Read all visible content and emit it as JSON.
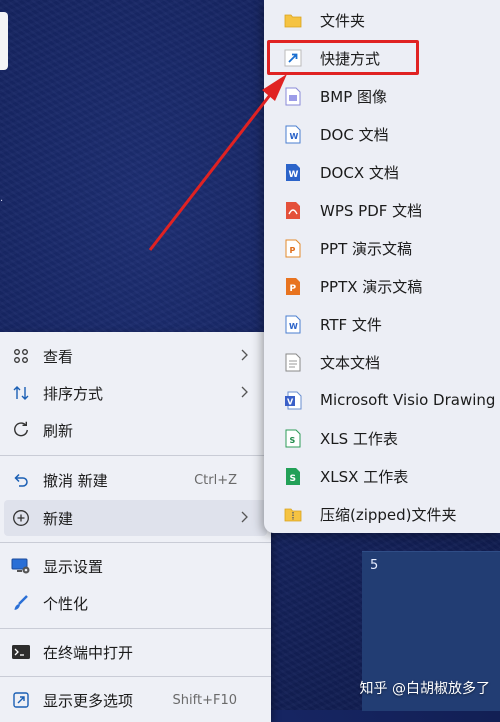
{
  "context_menu": {
    "items": [
      {
        "label": "查看",
        "icon": "grid-view-icon"
      },
      {
        "label": "排序方式",
        "icon": "sort-arrows-icon"
      },
      {
        "label": "刷新",
        "icon": "refresh-icon"
      },
      {
        "label": "撤消 新建",
        "shortcut": "Ctrl+Z",
        "icon": "undo-icon"
      },
      {
        "label": "新建",
        "icon": "add-circle-icon"
      },
      {
        "label": "显示设置",
        "icon": "display-settings-icon"
      },
      {
        "label": "个性化",
        "icon": "brush-icon"
      },
      {
        "label": "在终端中打开",
        "icon": "terminal-icon"
      },
      {
        "label": "显示更多选项",
        "shortcut": "Shift+F10",
        "icon": "more-options-icon"
      }
    ]
  },
  "new_submenu": {
    "items": [
      {
        "label": "文件夹",
        "icon": "folder-icon"
      },
      {
        "label": "快捷方式",
        "icon": "shortcut-icon"
      },
      {
        "label": "BMP 图像",
        "icon": "bmp-file-icon"
      },
      {
        "label": "DOC 文档",
        "icon": "doc-file-icon"
      },
      {
        "label": "DOCX 文档",
        "icon": "docx-file-icon"
      },
      {
        "label": "WPS PDF 文档",
        "icon": "pdf-file-icon"
      },
      {
        "label": "PPT 演示文稿",
        "icon": "ppt-file-icon"
      },
      {
        "label": "PPTX 演示文稿",
        "icon": "pptx-file-icon"
      },
      {
        "label": "RTF 文件",
        "icon": "rtf-file-icon"
      },
      {
        "label": "文本文档",
        "icon": "text-file-icon"
      },
      {
        "label": "Microsoft Visio Drawing",
        "icon": "visio-file-icon"
      },
      {
        "label": "XLS 工作表",
        "icon": "xls-file-icon"
      },
      {
        "label": "XLSX 工作表",
        "icon": "xlsx-file-icon"
      },
      {
        "label": "压缩(zipped)文件夹",
        "icon": "zip-folder-icon"
      }
    ]
  },
  "desktop": {
    "tile_number": "5",
    "watermark": "知乎 @白胡椒放多了"
  },
  "colors": {
    "highlight_box": "#e02222",
    "annotation_arrow": "#e02222",
    "desktop_bg": "#162562",
    "menu_bg": "#eef0f6"
  }
}
